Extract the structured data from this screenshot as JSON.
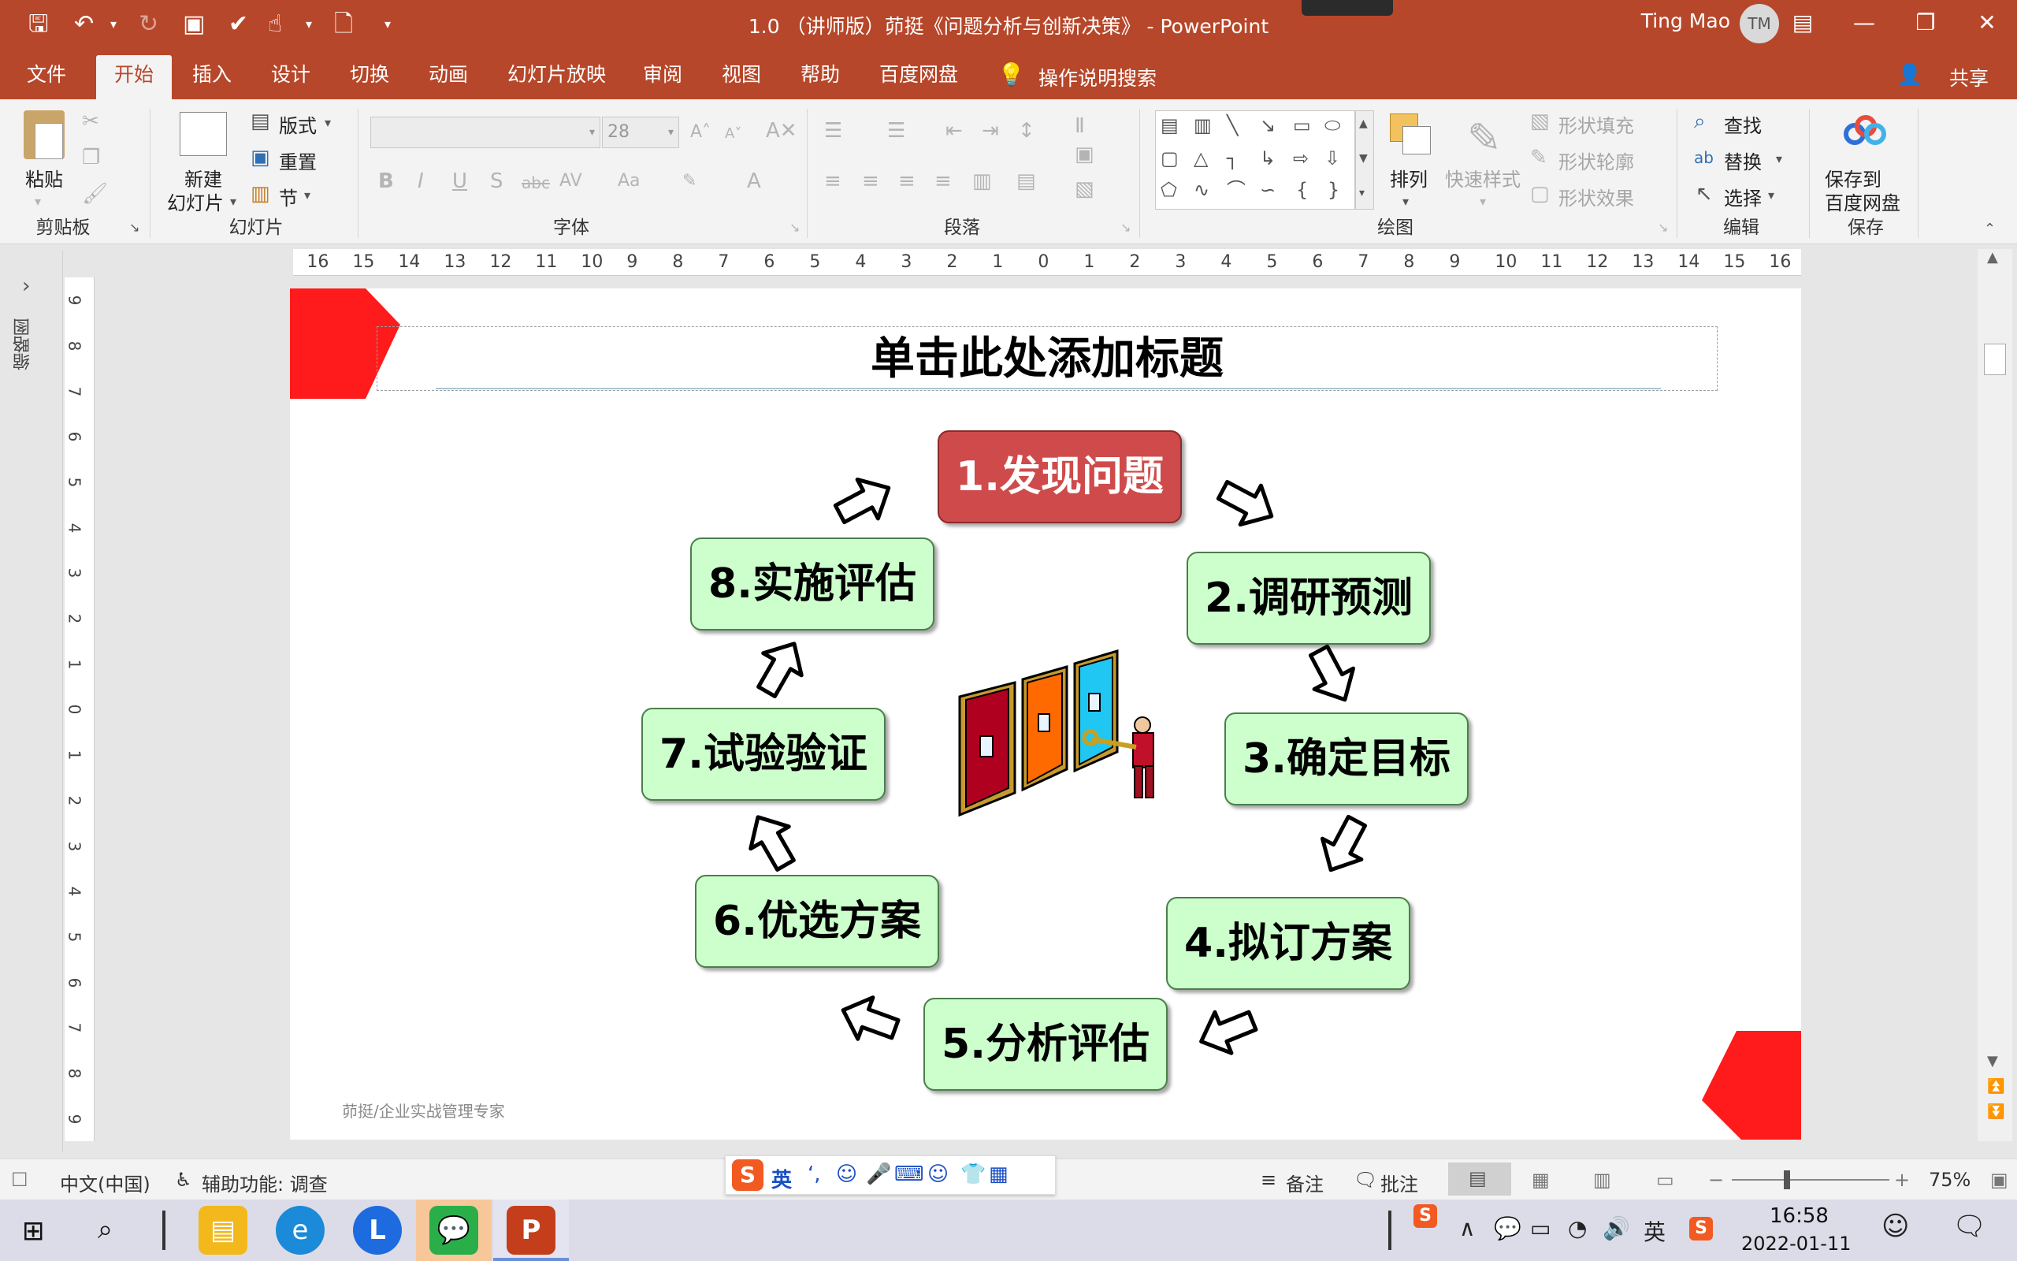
{
  "window": {
    "title": "1.0 （讲师版）茆挺《问题分析与创新决策》 - PowerPoint",
    "user_name": "Ting Mao",
    "user_initials": "TM",
    "accent_color": "#b7472a"
  },
  "tabs": [
    "文件",
    "开始",
    "插入",
    "设计",
    "切换",
    "动画",
    "幻灯片放映",
    "审阅",
    "视图",
    "帮助",
    "百度网盘"
  ],
  "tell_me": "操作说明搜索",
  "share_label": "共享",
  "ribbon": {
    "clipboard": {
      "paste": "粘贴",
      "group": "剪贴板"
    },
    "slides": {
      "new_slide_line1": "新建",
      "new_slide_line2": "幻灯片",
      "layout": "版式",
      "reset": "重置",
      "section": "节",
      "group": "幻灯片"
    },
    "font": {
      "size": "28",
      "group": "字体"
    },
    "paragraph": {
      "group": "段落"
    },
    "drawing": {
      "arrange": "排列",
      "quick_styles": "快速样式",
      "shape_fill": "形状填充",
      "shape_outline": "形状轮廓",
      "shape_effects": "形状效果",
      "group": "绘图"
    },
    "editing": {
      "find": "查找",
      "replace": "替换",
      "select": "选择",
      "group": "编辑"
    },
    "save": {
      "save_line1": "保存到",
      "save_line2": "百度网盘",
      "group": "保存"
    }
  },
  "thumbnail_pane_label": "缩略图",
  "slide": {
    "title": "单击此处添加标题",
    "steps": [
      "1.发现问题",
      "2.调研预测",
      "3.确定目标",
      "4.拟订方案",
      "5.分析评估",
      "6.优选方案",
      "7.试验验证",
      "8.实施评估"
    ],
    "footer": "茆挺/企业实战管理专家"
  },
  "status": {
    "language": "中文(中国)",
    "accessibility": "辅助功能: 调查",
    "notes": "备注",
    "comments": "批注",
    "zoom": "75%"
  },
  "ime": {
    "mode": "英"
  },
  "taskbar": {
    "time": "16:58",
    "date": "2022-01-11",
    "ime_tray": "英"
  },
  "ruler": {
    "h": [
      "16",
      "15",
      "14",
      "13",
      "12",
      "11",
      "10",
      "9",
      "8",
      "7",
      "6",
      "5",
      "4",
      "3",
      "2",
      "1",
      "0",
      "1",
      "2",
      "3",
      "4",
      "5",
      "6",
      "7",
      "8",
      "9",
      "10",
      "11",
      "12",
      "13",
      "14",
      "15",
      "16"
    ],
    "v": [
      "9",
      "8",
      "7",
      "6",
      "5",
      "4",
      "3",
      "2",
      "1",
      "0",
      "1",
      "2",
      "3",
      "4",
      "5",
      "6",
      "7",
      "8",
      "9"
    ]
  }
}
